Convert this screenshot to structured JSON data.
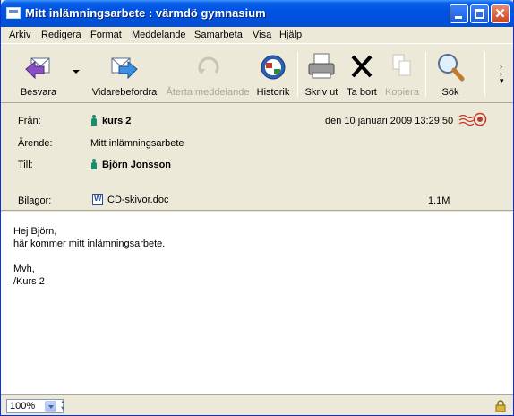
{
  "window": {
    "title": "Mitt inlämningsarbete : värmdö gymnasium",
    "controls": [
      "minimize",
      "maximize",
      "close"
    ]
  },
  "menu": [
    {
      "label": "Arkiv"
    },
    {
      "label": "Redigera"
    },
    {
      "label": "Format"
    },
    {
      "label": "Meddelande"
    },
    {
      "label": "Samarbeta"
    },
    {
      "label": "Visa"
    },
    {
      "label": "Hjälp"
    }
  ],
  "toolbar": {
    "reply": {
      "label": "Besvara",
      "icon": "reply-icon"
    },
    "forward": {
      "label": "Vidarebefordra",
      "icon": "forward-icon"
    },
    "recall": {
      "label": "Återta meddelande",
      "icon": "recall-icon",
      "disabled": true
    },
    "history": {
      "label": "Historik",
      "icon": "history-icon"
    },
    "print": {
      "label": "Skriv ut",
      "icon": "printer-icon"
    },
    "delete": {
      "label": "Ta bort",
      "icon": "delete-x-icon"
    },
    "copy": {
      "label": "Kopiera",
      "icon": "copy-icon",
      "disabled": true
    },
    "search": {
      "label": "Sök",
      "icon": "magnifier-icon"
    }
  },
  "header": {
    "from_label": "Från:",
    "from_value": "kurs 2",
    "date": "den 10 januari 2009 13:29:50",
    "subject_label": "Ärende:",
    "subject_value": "Mitt inlämningsarbete",
    "to_label": "Till:",
    "to_value": "Björn Jonsson",
    "attachments_label": "Bilagor:",
    "attachment_name": "CD-skivor.doc",
    "attachment_size": "1.1M"
  },
  "body": {
    "lines": [
      "Hej Björn,",
      "här kommer mitt inlämningsarbete.",
      "",
      "Mvh,",
      "/Kurs 2"
    ]
  },
  "status": {
    "zoom": "100%"
  }
}
